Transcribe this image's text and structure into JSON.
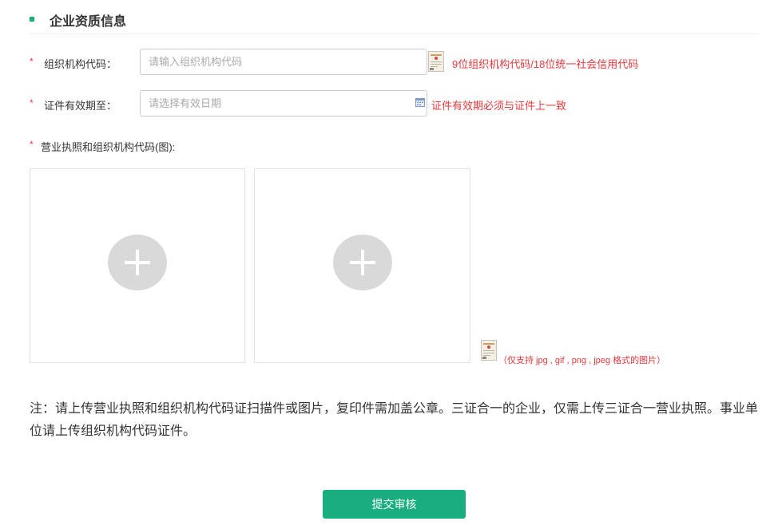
{
  "section": {
    "title": "企业资质信息",
    "accent_color": "#1aad7e"
  },
  "form": {
    "required_mark": "*",
    "org_code": {
      "label": "组织机构代码：",
      "placeholder": "请输入组织机构代码",
      "hint": "9位组织机构代码/18位统一社会信用代码",
      "sample_icon": "certificate-sample-icon"
    },
    "validity": {
      "label": "证件有效期至：",
      "placeholder": "请选择有效日期",
      "hint": "证件有效期必须与证件上一致",
      "icon": "calendar-icon"
    },
    "upload": {
      "label": "营业执照和组织机构代码(图):",
      "format_hint": "（仅支持 jpg , gif , png , jpeg 格式的图片）",
      "add_icon": "plus-circle-icon"
    }
  },
  "note": "注：请上传营业执照和组织机构代码证扫描件或图片，复印件需加盖公章。三证合一的企业，仅需上传三证合一营业执照。事业单位请上传组织机构代码证件。",
  "submit_label": "提交审核",
  "colors": {
    "hint_red": "#e4393c",
    "button_green": "#1aad7e",
    "plus_gray": "#d9d9d9"
  }
}
